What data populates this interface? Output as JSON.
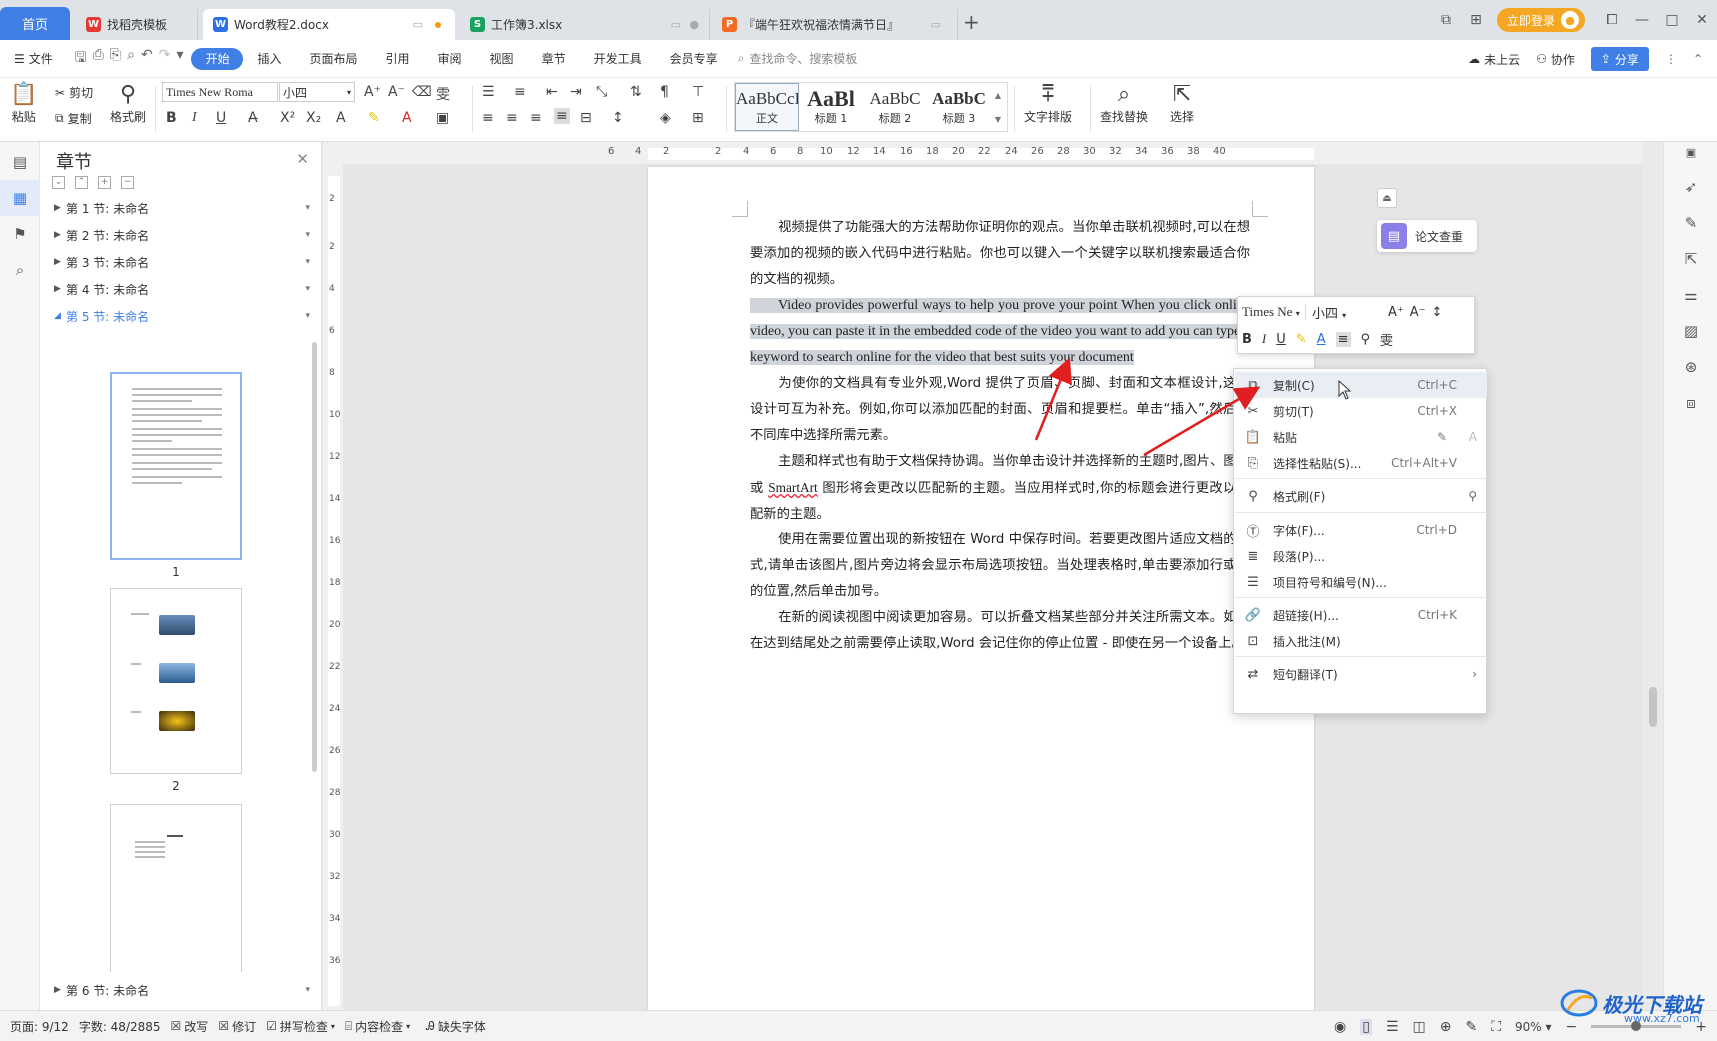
{
  "tabs": {
    "home": "首页",
    "items": [
      {
        "label": "找稻壳模板",
        "icon": "docer-icon",
        "color": "#e53935"
      },
      {
        "label": "Word教程2.docx",
        "icon": "word-icon",
        "color": "#2b6fe0",
        "active": true
      },
      {
        "label": "工作簿3.xlsx",
        "icon": "excel-icon",
        "color": "#1aa260"
      },
      {
        "label": "『端午狂欢祝福浓情满节日』",
        "icon": "ppt-icon",
        "color": "#f26b21"
      }
    ],
    "login": "立即登录"
  },
  "menubar": {
    "file": "文件",
    "items": [
      "开始",
      "插入",
      "页面布局",
      "引用",
      "审阅",
      "视图",
      "章节",
      "开发工具",
      "会员专享"
    ],
    "active": "开始",
    "search_placeholder": "查找命令、搜索模板",
    "cloud": "未上云",
    "collab": "协作",
    "share": "分享"
  },
  "ribbon": {
    "paste": "粘贴",
    "cut": "剪切",
    "copy": "复制",
    "format_painter": "格式刷",
    "font_name": "Times New Roma",
    "font_size": "小四",
    "styles": [
      {
        "sample": "AaBbCcI",
        "name": "正文"
      },
      {
        "sample": "AaBl",
        "name": "标题 1"
      },
      {
        "sample": "AaBbC",
        "name": "标题 2"
      },
      {
        "sample": "AaBbC",
        "name": "标题 3"
      }
    ],
    "text_layout": "文字排版",
    "find_replace": "查找替换",
    "select": "选择"
  },
  "chapter_panel": {
    "title": "章节",
    "sections": [
      {
        "label": "第 1 节: 未命名"
      },
      {
        "label": "第 2 节: 未命名"
      },
      {
        "label": "第 3 节: 未命名"
      },
      {
        "label": "第 4 节: 未命名"
      },
      {
        "label": "第 5 节: 未命名",
        "active": true
      }
    ],
    "last_section": "第 6 节: 未命名",
    "page_numbers": [
      "1",
      "2"
    ]
  },
  "ruler": {
    "h_numbers": [
      "6",
      "4",
      "2",
      "2",
      "4",
      "6",
      "8",
      "10",
      "12",
      "14",
      "16",
      "18",
      "20",
      "22",
      "24",
      "26",
      "28",
      "30",
      "32",
      "34",
      "36",
      "38",
      "40"
    ],
    "v_numbers": [
      "2",
      "2",
      "4",
      "6",
      "8",
      "10",
      "12",
      "14",
      "16",
      "18",
      "20",
      "22",
      "24",
      "26",
      "28",
      "30",
      "32",
      "34",
      "36"
    ]
  },
  "document": {
    "p1": "视频提供了功能强大的方法帮助你证明你的观点。当你单击联机视频时,可以在想要添加的视频的嵌入代码中进行粘贴。你也可以键入一个关键字以联机搜索最适合你的文档的视频。",
    "p2": "Video provides powerful ways to help you prove your point When you click online video, you can paste it in the embedded code of the video you want to add you can type a keyword to search online for the video that best suits your document",
    "p3": "为使你的文档具有专业外观,Word 提供了页眉、页脚、封面和文本框设计,这些设计可互为补充。例如,你可以添加匹配的封面、页眉和提要栏。单击“插入”,然后从不同库中选择所需元素。",
    "p4_a": "主题和样式也有助于文档保持协调。当你单击设计并选择新的主题时,图片、图表或 ",
    "p4_smart": "SmartArt",
    "p4_b": " 图形将会更改以匹配新的主题。当应用样式时,你的标题会进行更改以匹配新的主题。",
    "p5": "使用在需要位置出现的新按钮在 Word 中保存时间。若要更改图片适应文档的方式,请单击该图片,图片旁边将会显示布局选项按钮。当处理表格时,单击要添加行或列的位置,然后单击加号。",
    "p6": "在新的阅读视图中阅读更加容易。可以折叠文档某些部分并关注所需文本。如果在达到结尾处之前需要停止读取,Word 会记住你的停止位置 - 即使在另一个设备上。"
  },
  "side_float": {
    "thesis": "论文查重"
  },
  "mini_toolbar": {
    "font": "Times Ne",
    "size": "小四"
  },
  "context_menu": {
    "items": [
      {
        "icon": "copy-icon",
        "label": "复制(C)",
        "shortcut": "Ctrl+C"
      },
      {
        "icon": "scissors-icon",
        "label": "剪切(T)",
        "shortcut": "Ctrl+X"
      },
      {
        "icon": "paste-icon",
        "label": "粘贴",
        "shortcut": ""
      },
      {
        "icon": "paste-special-icon",
        "label": "选择性粘贴(S)...",
        "shortcut": "Ctrl+Alt+V"
      },
      {
        "icon": "format-painter-icon",
        "label": "格式刷(F)",
        "shortcut": ""
      },
      {
        "icon": "font-icon",
        "label": "字体(F)...",
        "shortcut": "Ctrl+D"
      },
      {
        "icon": "paragraph-icon",
        "label": "段落(P)...",
        "shortcut": ""
      },
      {
        "icon": "list-icon",
        "label": "项目符号和编号(N)...",
        "shortcut": ""
      },
      {
        "icon": "link-icon",
        "label": "超链接(H)...",
        "shortcut": "Ctrl+K"
      },
      {
        "icon": "comment-icon",
        "label": "插入批注(M)",
        "shortcut": ""
      },
      {
        "icon": "translate-icon",
        "label": "短句翻译(T)",
        "shortcut": ""
      }
    ]
  },
  "statusbar": {
    "page": "页面: 9/12",
    "words": "字数: 48/2885",
    "rewrite": "改写",
    "revise": "修订",
    "spell": "拼写检查",
    "content": "内容检查",
    "missing_font": "缺失字体",
    "zoom": "90%"
  },
  "watermark": {
    "title": "极光下载站",
    "url": "www.xz7.com"
  },
  "colors": {
    "accent": "#3f7fe6",
    "highlight": "#cfd4da",
    "arrow": "#e02020"
  }
}
